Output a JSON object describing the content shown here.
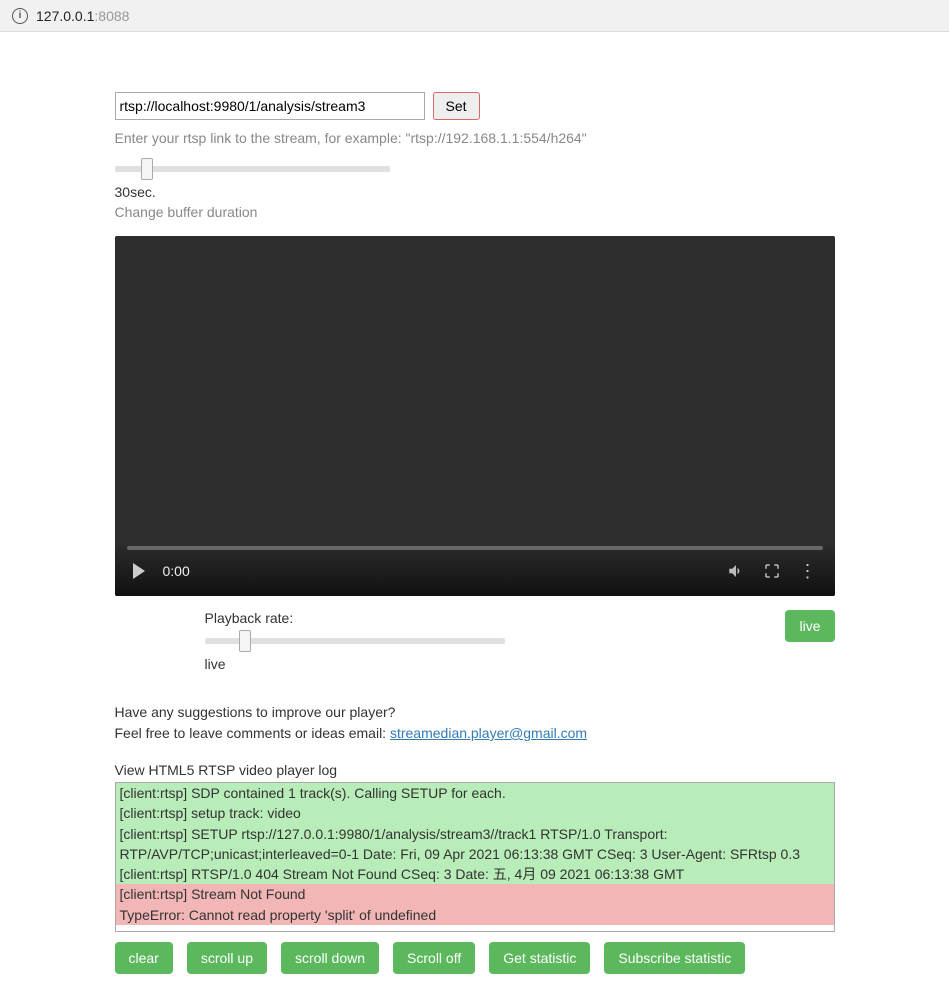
{
  "address_bar": {
    "host": "127.0.0.1",
    "port": ":8088"
  },
  "url_input": {
    "value": "rtsp://localhost:9980/1/analysis/stream3"
  },
  "set_button": "Set",
  "url_hint": "Enter your rtsp link to the stream, for example: \"rtsp://192.168.1.1:554/h264\"",
  "buffer": {
    "value_label": "30sec.",
    "hint": "Change buffer duration"
  },
  "video": {
    "time": "0:00"
  },
  "playback": {
    "label": "Playback rate:",
    "value": "live",
    "live_button": "live"
  },
  "suggestion": {
    "line1": "Have any suggestions to improve our player?",
    "line2_prefix": "Feel free to leave comments or ideas email: ",
    "email": "streamedian.player@gmail.com"
  },
  "log_title": "View HTML5 RTSP video player log",
  "log": {
    "green": [
      "[client:rtsp] SDP contained 1 track(s). Calling SETUP for each.",
      "[client:rtsp] setup track: video",
      "[client:rtsp] SETUP rtsp://127.0.0.1:9980/1/analysis/stream3//track1 RTSP/1.0 Transport: RTP/AVP/TCP;unicast;interleaved=0-1 Date: Fri, 09 Apr 2021 06:13:38 GMT CSeq: 3 User-Agent: SFRtsp 0.3",
      "[client:rtsp] RTSP/1.0 404 Stream Not Found CSeq: 3 Date: 五, 4月 09 2021 06:13:38 GMT"
    ],
    "red": [
      "[client:rtsp] Stream Not Found",
      "TypeError: Cannot read property 'split' of undefined"
    ]
  },
  "buttons": {
    "clear": "clear",
    "scroll_up": "scroll up",
    "scroll_down": "scroll down",
    "scroll_off": "Scroll off",
    "get_statistic": "Get statistic",
    "subscribe_statistic": "Subscribe statistic"
  }
}
